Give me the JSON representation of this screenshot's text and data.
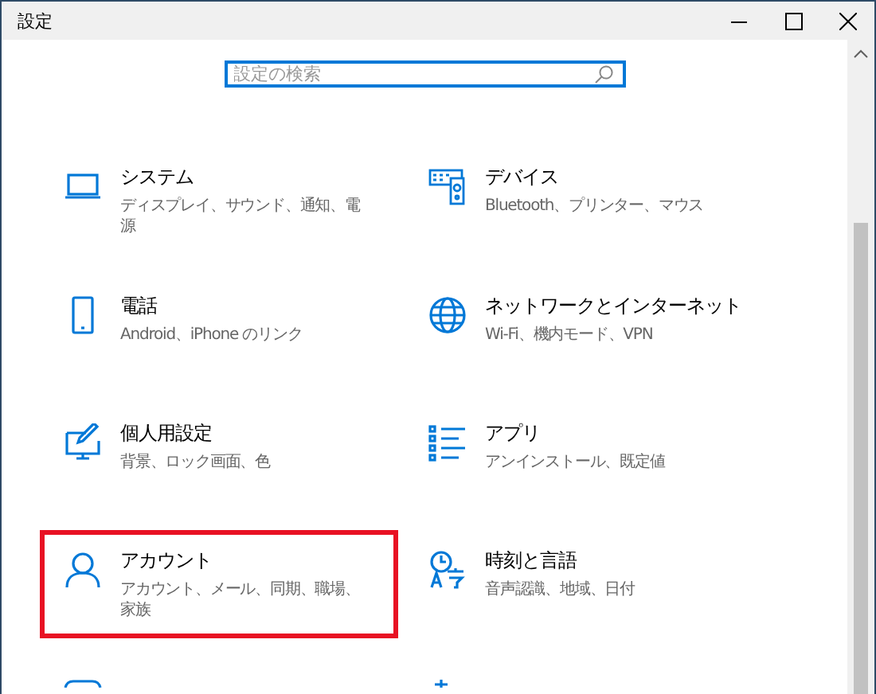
{
  "window": {
    "title": "設定"
  },
  "search": {
    "placeholder": "設定の検索"
  },
  "categories": [
    {
      "kind": "system",
      "title": "システム",
      "subtitle": "ディスプレイ、サウンド、通知、電源",
      "highlighted": false
    },
    {
      "kind": "devices",
      "title": "デバイス",
      "subtitle": "Bluetooth、プリンター、マウス",
      "highlighted": false
    },
    {
      "kind": "phone",
      "title": "電話",
      "subtitle": "Android、iPhone のリンク",
      "highlighted": false
    },
    {
      "kind": "network",
      "title": "ネットワークとインターネット",
      "subtitle": "Wi-Fi、機内モード、VPN",
      "highlighted": false
    },
    {
      "kind": "personalization",
      "title": "個人用設定",
      "subtitle": "背景、ロック画面、色",
      "highlighted": false
    },
    {
      "kind": "apps",
      "title": "アプリ",
      "subtitle": "アンインストール、既定値",
      "highlighted": false
    },
    {
      "kind": "accounts",
      "title": "アカウント",
      "subtitle": "アカウント、メール、同期、職場、家族",
      "highlighted": true
    },
    {
      "kind": "time",
      "title": "時刻と言語",
      "subtitle": "音声認識、地域、日付",
      "highlighted": false
    },
    {
      "kind": "gaming",
      "highlighted": false
    },
    {
      "kind": "ease",
      "highlighted": false
    }
  ]
}
